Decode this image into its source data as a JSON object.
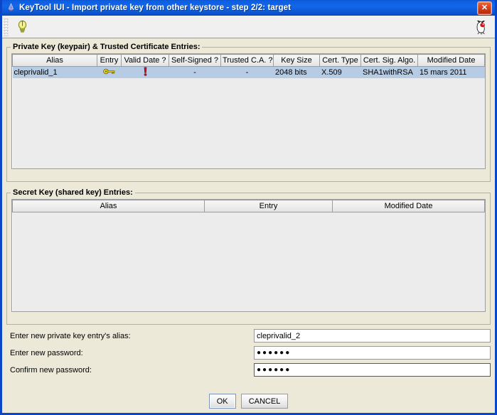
{
  "window": {
    "title": "KeyTool IUI - Import private key from other keystore - step 2/2: target",
    "app_icon": "java-cup-icon",
    "close_label": "✕"
  },
  "toolbar": {
    "help_icon": "lightbulb-info-icon",
    "mascot_icon": "duke-mascot-icon"
  },
  "private_key_group": {
    "legend": "Private Key (keypair) & Trusted Certificate Entries:",
    "columns": [
      "Alias",
      "Entry",
      "Valid Date ?",
      "Self-Signed ?",
      "Trusted C.A. ?",
      "Key Size",
      "Cert. Type",
      "Cert. Sig. Algo.",
      "Modified Date"
    ],
    "rows": [
      {
        "alias": "cleprivalid_1",
        "entry_icon": "key-icon",
        "valid_date_icon": "red-exclamation-icon",
        "self_signed": "-",
        "trusted_ca": "-",
        "key_size": "2048 bits",
        "cert_type": "X.509",
        "cert_sig_algo": "SHA1withRSA",
        "modified_date": "15 mars 2011"
      }
    ]
  },
  "secret_key_group": {
    "legend": "Secret Key (shared key) Entries:",
    "columns": [
      "Alias",
      "Entry",
      "Modified Date"
    ],
    "rows": []
  },
  "form": {
    "fields": [
      {
        "label": "Enter new private key entry's alias:",
        "value": "cleprivalid_2",
        "type": "text",
        "placeholder": ""
      },
      {
        "label": "Enter new password:",
        "value": "●●●●●●",
        "type": "password",
        "placeholder": ""
      },
      {
        "label": "Confirm new password:",
        "value": "●●●●●●",
        "type": "password",
        "placeholder": ""
      }
    ]
  },
  "buttons": {
    "ok": "OK",
    "cancel": "CANCEL"
  },
  "colors": {
    "title_bar": "#0a56d6",
    "window_border": "#0a46c8",
    "selection": "#b6cbe4",
    "panel": "#ece9d8",
    "table_body": "#ececec",
    "close_button": "#d6431c"
  }
}
